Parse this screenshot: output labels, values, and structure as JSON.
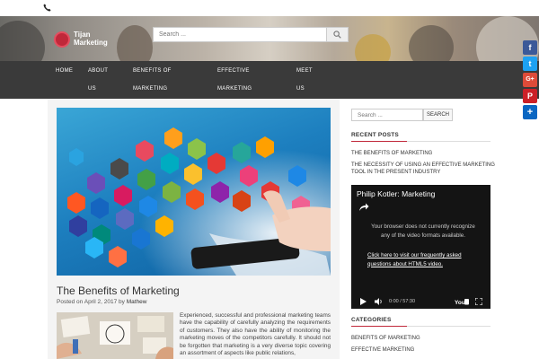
{
  "site": {
    "logo_text": "Tijan Marketing"
  },
  "header": {
    "search_placeholder": "Search ..."
  },
  "nav": {
    "items": [
      {
        "label": "HOME"
      },
      {
        "label": "ABOUT"
      },
      {
        "label": "US"
      },
      {
        "label": "BENEFITS OF"
      },
      {
        "label": "MARKETING"
      },
      {
        "label": "EFFECTIVE"
      },
      {
        "label": "MARKETING"
      },
      {
        "label": "MEET"
      },
      {
        "label": "US"
      }
    ]
  },
  "post": {
    "title": "The Benefits of Marketing",
    "meta_prefix": "Posted on",
    "date": "April 2, 2017",
    "meta_by": "by",
    "author": "Mathew",
    "excerpt": "Experienced, successful and professional marketing teams have the capability of carefully analyzing the requirements of customers. They also have the ability of monitoring the marketing moves of the competitors carefully. It should not be forgotten that marketing is a very diverse topic covering an assortment of aspects like public relations,"
  },
  "sidebar": {
    "search_placeholder": "Search ...",
    "search_button": "SEARCH",
    "recent_title": "RECENT POSTS",
    "recent_posts": [
      "THE BENEFITS OF MARKETING",
      "THE NECESSITY OF USING AN EFFECTIVE MARKETING TOOL IN THE PRESENT INDUSTRY"
    ],
    "video": {
      "title": "Philip Kotler: Marketing",
      "message": "Your browser does not currently recognize any of the video formats available.",
      "link": "Click here to visit our frequently asked questions about HTML5 video.",
      "time": "0:00 / 57:30"
    },
    "categories_title": "CATEGORIES",
    "categories": [
      "BENEFITS OF MARKETING",
      "EFFECTIVE MARKETING"
    ]
  },
  "social": [
    {
      "name": "facebook",
      "glyph": "f",
      "color": "#3b5998"
    },
    {
      "name": "twitter",
      "glyph": "t",
      "color": "#1da1f2"
    },
    {
      "name": "google-plus",
      "glyph": "G+",
      "color": "#dd4b39"
    },
    {
      "name": "pinterest",
      "glyph": "P",
      "color": "#cb2027"
    },
    {
      "name": "share",
      "glyph": "+",
      "color": "#0a66c2"
    }
  ],
  "colors": {
    "accent": "#c0283a",
    "nav_bg": "#3a3a3a",
    "video_bg": "#141414"
  }
}
